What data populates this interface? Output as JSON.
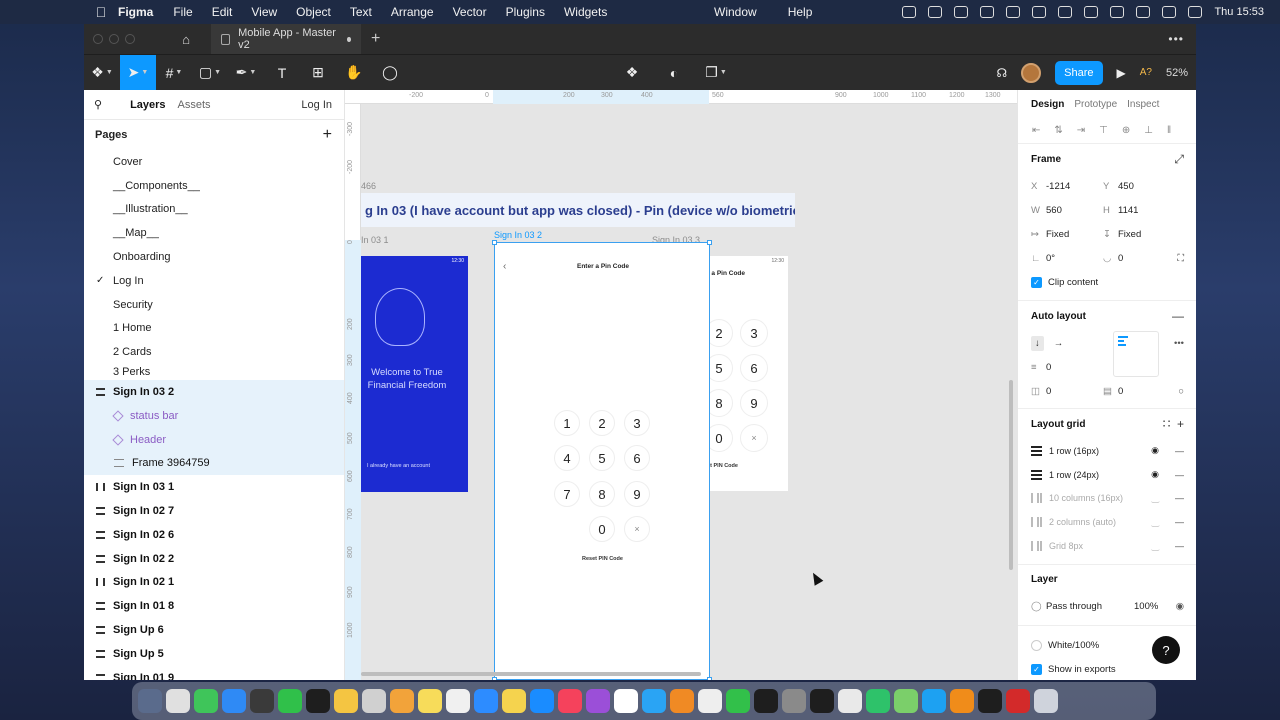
{
  "menubar": {
    "app_name": "Figma",
    "menus": [
      "File",
      "Edit",
      "View",
      "Object",
      "Text",
      "Arrange",
      "Vector",
      "Plugins",
      "Widgets"
    ],
    "right_menus": [
      "Window",
      "Help"
    ],
    "clock": "Thu 15:53"
  },
  "tabbar": {
    "doc_tab_label": "Mobile App - Master v2",
    "new_tab": "+",
    "more": "•••"
  },
  "toolbar": {
    "share_label": "Share",
    "zoom_label": "52%",
    "ai_badge": "A?"
  },
  "left_panel": {
    "tabs": {
      "layers": "Layers",
      "assets": "Assets",
      "page_dropdown": "Log In"
    },
    "pages_title": "Pages",
    "pages": [
      "Cover",
      "__Components__",
      "__Illustration__",
      "__Map__",
      "Onboarding",
      "Log In",
      "Security",
      "1 Home",
      "2 Cards",
      "3 Perks"
    ],
    "current_page": "Log In",
    "layers": [
      {
        "label": "Sign In 03 2",
        "kind": "row",
        "selected": true
      },
      {
        "label": "status bar",
        "kind": "component",
        "selected": true
      },
      {
        "label": "Header",
        "kind": "component",
        "selected": true
      },
      {
        "label": "Frame 3964759",
        "kind": "frame",
        "selected": true
      },
      {
        "label": "Sign In 03 1",
        "kind": "col"
      },
      {
        "label": "Sign In 02 7",
        "kind": "row"
      },
      {
        "label": "Sign In 02 6",
        "kind": "row"
      },
      {
        "label": "Sign In 02 2",
        "kind": "row"
      },
      {
        "label": "Sign In 02 1",
        "kind": "col"
      },
      {
        "label": "Sign In 01 8",
        "kind": "row"
      },
      {
        "label": "Sign Up 6",
        "kind": "row"
      },
      {
        "label": "Sign Up 5",
        "kind": "row"
      },
      {
        "label": "Sign In 01 9",
        "kind": "row"
      }
    ]
  },
  "canvas": {
    "ruler_top": [
      "-200",
      "0",
      "200",
      "300",
      "400",
      "560",
      "900",
      "1000",
      "1100",
      "1200",
      "1300"
    ],
    "ruler_left": [
      "-300",
      "-200",
      "0",
      "200",
      "300",
      "400",
      "500",
      "600",
      "700",
      "800",
      "900",
      "1000"
    ],
    "section_label": "466",
    "banner_title": "g In 03 (I have account but app was closed) - Pin (device w/o biometric)",
    "frame_label_left": "In 03 1",
    "frame_label_selected": "Sign In 03 2",
    "frame_label_right": "Sign In 03 3",
    "welcome_text": "Welcome to True Financial Freedom",
    "already_account": "I already have an account",
    "pin_title": "Enter a Pin Code",
    "keys": [
      "1",
      "2",
      "3",
      "4",
      "5",
      "6",
      "7",
      "8",
      "9",
      "0",
      "×"
    ],
    "reset_pin": "Reset PIN Code",
    "status_time": "12:30"
  },
  "right_panel": {
    "tabs": [
      "Design",
      "Prototype",
      "Inspect"
    ],
    "frame": {
      "title": "Frame",
      "x": "-1214",
      "y": "450",
      "w": "560",
      "h": "1141",
      "width_mode": "Fixed",
      "height_mode": "Fixed",
      "rotation": "0°",
      "radius": "0",
      "clip_label": "Clip content"
    },
    "auto_layout": {
      "title": "Auto layout",
      "gap": "0",
      "padding_h": "0",
      "padding_v": "0"
    },
    "layout_grid": {
      "title": "Layout grid",
      "grids": [
        {
          "label": "1 row (16px)",
          "visible": true
        },
        {
          "label": "1 row (24px)",
          "visible": true
        },
        {
          "label": "10 columns (16px)",
          "visible": false
        },
        {
          "label": "2 columns (auto)",
          "visible": false
        },
        {
          "label": "Grid 8px",
          "visible": false
        }
      ]
    },
    "layer": {
      "title": "Layer",
      "blend": "Pass through",
      "opacity": "100%"
    },
    "fill": {
      "label": "White/100%"
    },
    "export": {
      "label": "Show in exports"
    },
    "help": "?"
  },
  "colors": {
    "accent": "#0d99ff",
    "brand_blue": "#1c2bd1",
    "purple_component": "#8b5cc4"
  }
}
